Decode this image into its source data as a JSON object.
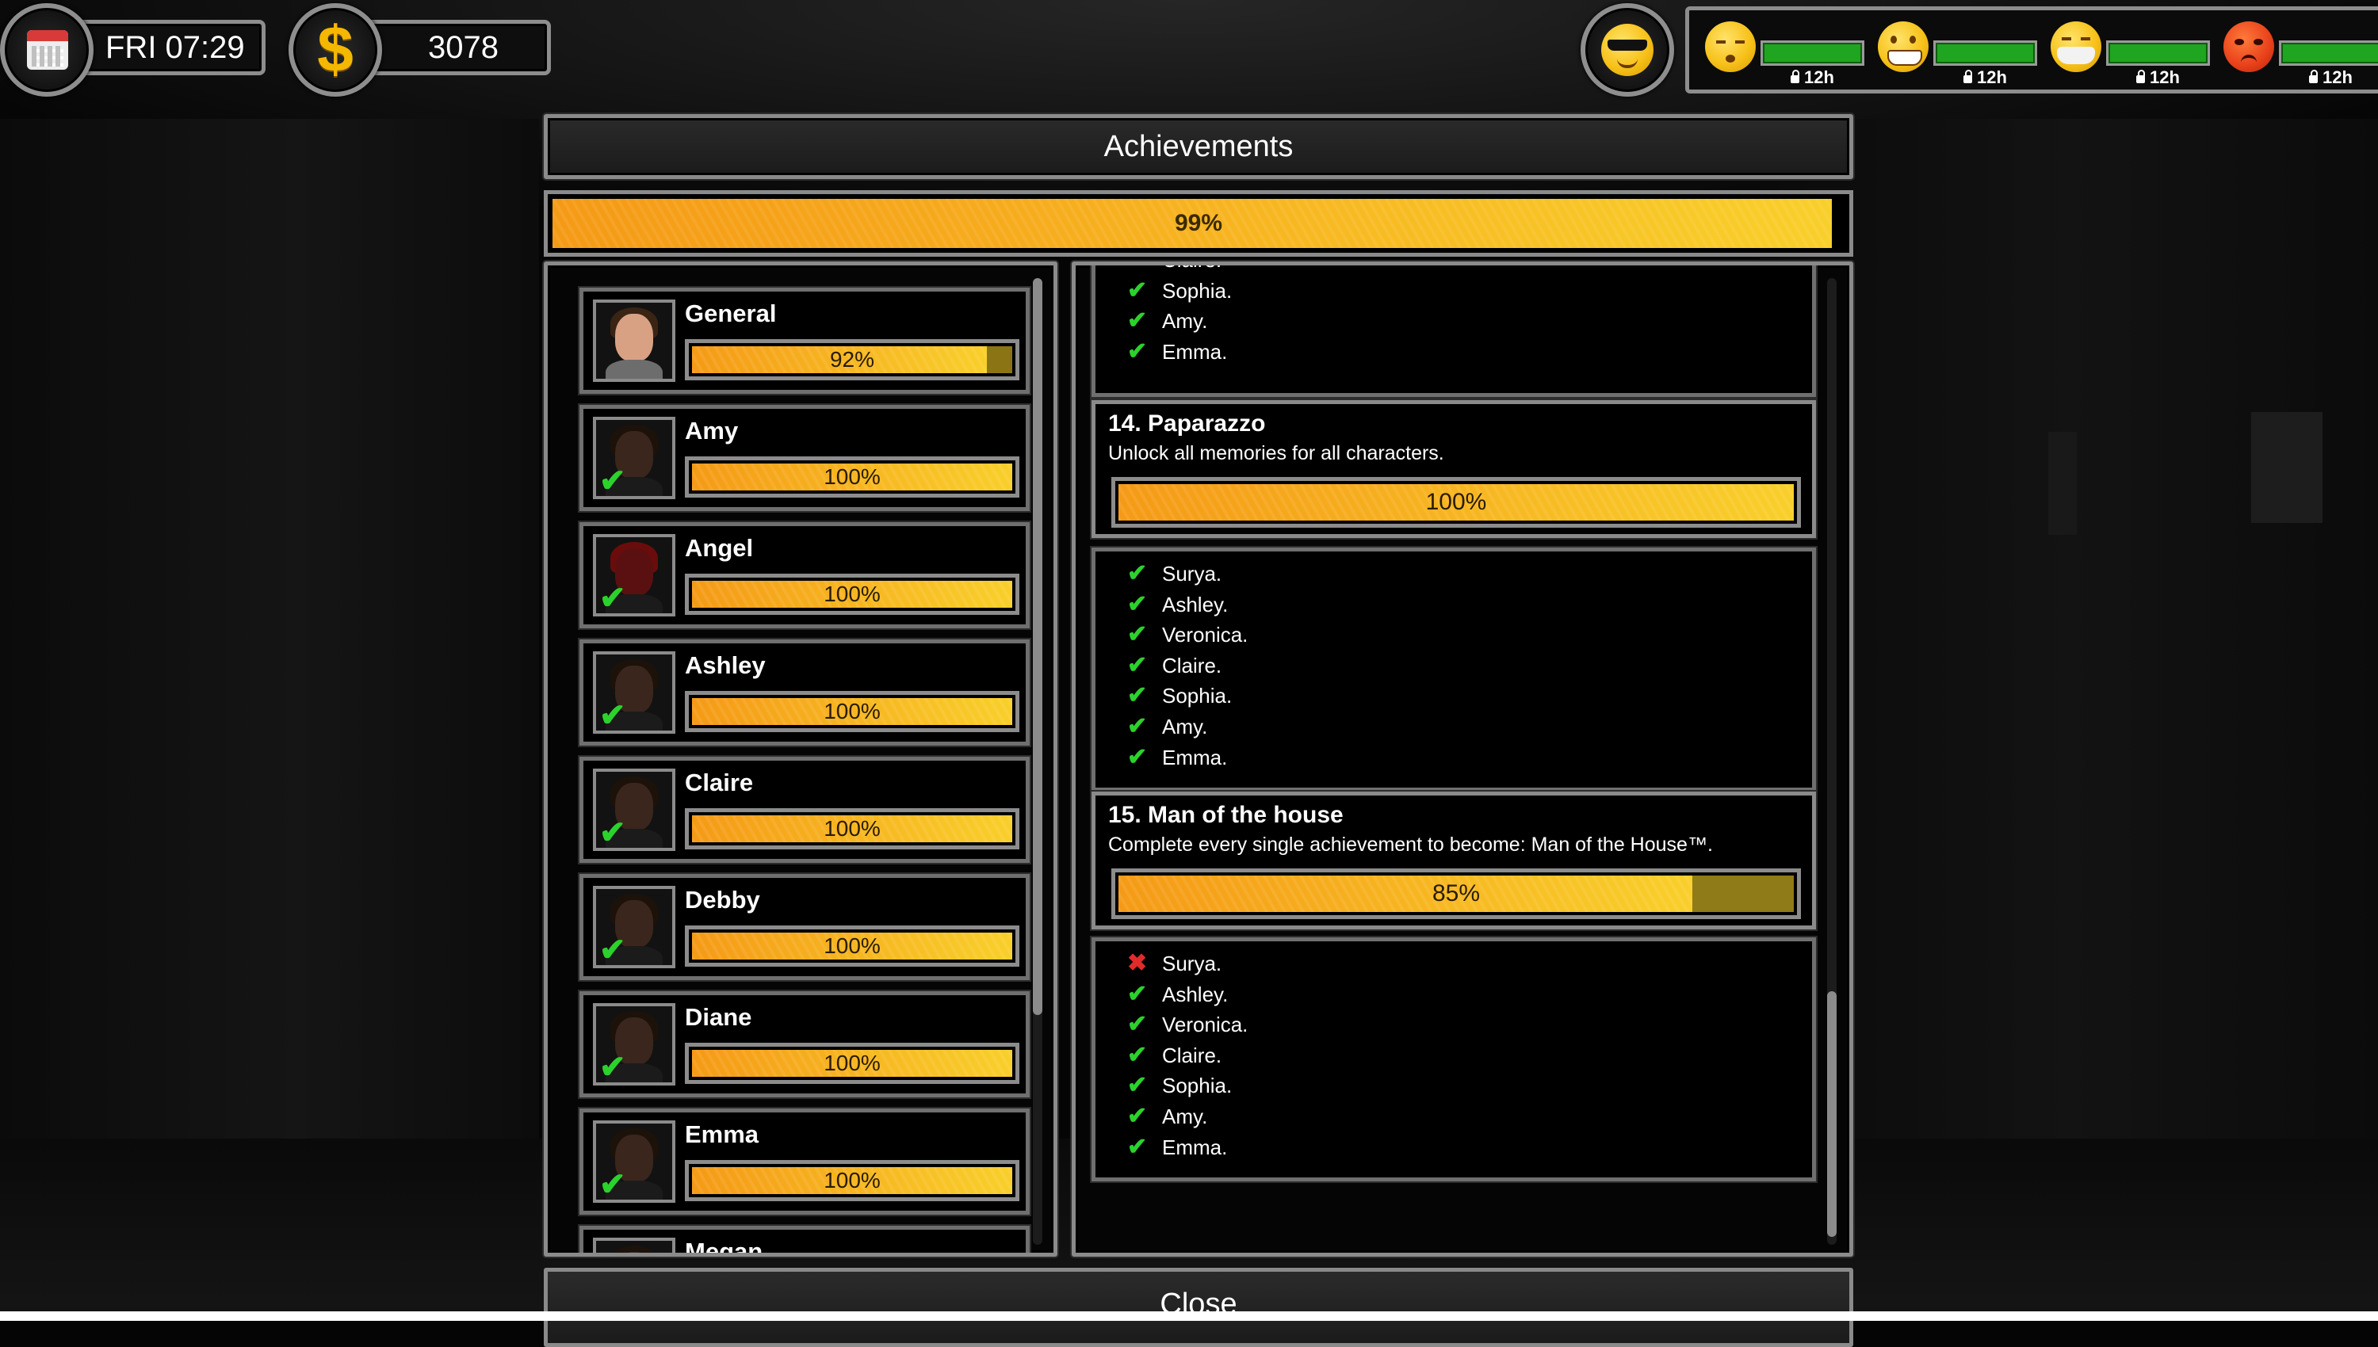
{
  "hud": {
    "day_time": "FRI 07:29",
    "money": "3078",
    "mood_icon": "cool-sunglasses-icon",
    "stats": [
      {
        "icon": "sleepy-face-icon",
        "timer": "12h",
        "level": 1.0
      },
      {
        "icon": "grinning-face-icon",
        "timer": "12h",
        "level": 1.0
      },
      {
        "icon": "mask-face-icon",
        "timer": "12h",
        "level": 1.0
      },
      {
        "icon": "angry-face-icon",
        "timer": "12h",
        "level": 1.0
      }
    ]
  },
  "window": {
    "title": "Achievements",
    "overall_label": "99%",
    "overall_progress": 0.99,
    "close_label": "Close"
  },
  "characters": [
    {
      "name": "General",
      "label": "92%",
      "progress": 0.92,
      "done": false
    },
    {
      "name": "Amy",
      "label": "100%",
      "progress": 1.0,
      "done": true
    },
    {
      "name": "Angel",
      "label": "100%",
      "progress": 1.0,
      "done": true
    },
    {
      "name": "Ashley",
      "label": "100%",
      "progress": 1.0,
      "done": true
    },
    {
      "name": "Claire",
      "label": "100%",
      "progress": 1.0,
      "done": true
    },
    {
      "name": "Debby",
      "label": "100%",
      "progress": 1.0,
      "done": true
    },
    {
      "name": "Diane",
      "label": "100%",
      "progress": 1.0,
      "done": true
    },
    {
      "name": "Emma",
      "label": "100%",
      "progress": 1.0,
      "done": true
    },
    {
      "name": "Megan",
      "label": "",
      "progress": 1.0,
      "done": true
    }
  ],
  "achievement_list_top": {
    "items": [
      {
        "text": "Claire.",
        "ok": true
      },
      {
        "text": "Sophia.",
        "ok": true
      },
      {
        "text": "Amy.",
        "ok": true
      },
      {
        "text": "Emma.",
        "ok": true
      }
    ]
  },
  "achievements": [
    {
      "title": "14. Paparazzo",
      "description": "Unlock all memories for all characters.",
      "label": "100%",
      "progress": 1.0,
      "items": [
        {
          "text": "Surya.",
          "ok": true
        },
        {
          "text": "Ashley.",
          "ok": true
        },
        {
          "text": "Veronica.",
          "ok": true
        },
        {
          "text": "Claire.",
          "ok": true
        },
        {
          "text": "Sophia.",
          "ok": true
        },
        {
          "text": "Amy.",
          "ok": true
        },
        {
          "text": "Emma.",
          "ok": true
        }
      ]
    },
    {
      "title": "15. Man of the house",
      "description": "Complete every single achievement to become: Man of the House™.",
      "label": "85%",
      "progress": 0.85,
      "items": [
        {
          "text": "Surya.",
          "ok": false
        },
        {
          "text": "Ashley.",
          "ok": true
        },
        {
          "text": "Veronica.",
          "ok": true
        },
        {
          "text": "Claire.",
          "ok": true
        },
        {
          "text": "Sophia.",
          "ok": true
        },
        {
          "text": "Amy.",
          "ok": true
        },
        {
          "text": "Emma.",
          "ok": true
        }
      ]
    }
  ],
  "colors": {
    "accent_orange": "#f59a16",
    "accent_yellow": "#f9cf2a",
    "check_green": "#2cd22c",
    "cross_red": "#e02b2b",
    "stat_green": "#1fa51f"
  }
}
